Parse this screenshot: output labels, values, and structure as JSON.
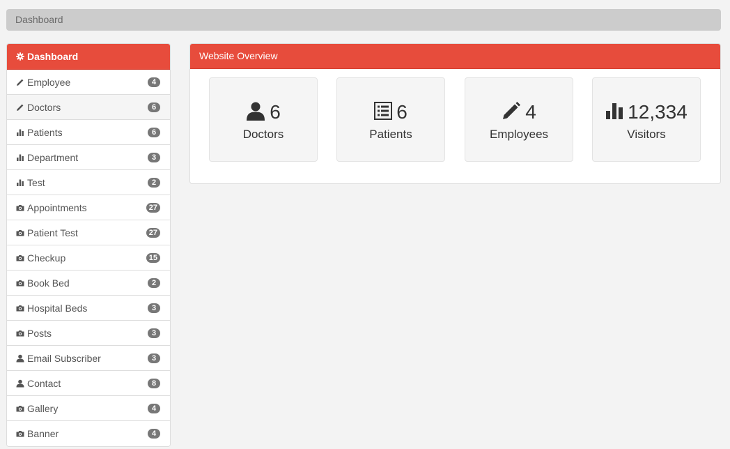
{
  "breadcrumb": {
    "label": "Dashboard"
  },
  "sidebar": {
    "items": [
      {
        "label": "Dashboard",
        "icon": "gear-icon",
        "badge": ""
      },
      {
        "label": "Employee",
        "icon": "pencil-icon",
        "badge": "4"
      },
      {
        "label": "Doctors",
        "icon": "pencil-icon",
        "badge": "6"
      },
      {
        "label": "Patients",
        "icon": "bar-chart-icon",
        "badge": "6"
      },
      {
        "label": "Department",
        "icon": "bar-chart-icon",
        "badge": "3"
      },
      {
        "label": "Test",
        "icon": "bar-chart-icon",
        "badge": "2"
      },
      {
        "label": "Appointments",
        "icon": "camera-icon",
        "badge": "27"
      },
      {
        "label": "Patient Test",
        "icon": "camera-icon",
        "badge": "27"
      },
      {
        "label": "Checkup",
        "icon": "camera-icon",
        "badge": "15"
      },
      {
        "label": "Book Bed",
        "icon": "camera-icon",
        "badge": "2"
      },
      {
        "label": "Hospital Beds",
        "icon": "camera-icon",
        "badge": "3"
      },
      {
        "label": "Posts",
        "icon": "camera-icon",
        "badge": "3"
      },
      {
        "label": "Email Subscriber",
        "icon": "user-icon",
        "badge": "3"
      },
      {
        "label": "Contact",
        "icon": "user-icon",
        "badge": "8"
      },
      {
        "label": "Gallery",
        "icon": "camera-icon",
        "badge": "4"
      },
      {
        "label": "Banner",
        "icon": "camera-icon",
        "badge": "4"
      }
    ]
  },
  "overview": {
    "title": "Website Overview",
    "cards": [
      {
        "value": "6",
        "label": "Doctors",
        "icon": "user-icon"
      },
      {
        "value": "6",
        "label": "Patients",
        "icon": "list-icon"
      },
      {
        "value": "4",
        "label": "Employees",
        "icon": "pencil-icon"
      },
      {
        "value": "12,334",
        "label": "Visitors",
        "icon": "bar-chart-icon"
      }
    ]
  },
  "colors": {
    "accent": "#e74c3c",
    "badge": "#777777",
    "background": "#f3f3f3"
  }
}
